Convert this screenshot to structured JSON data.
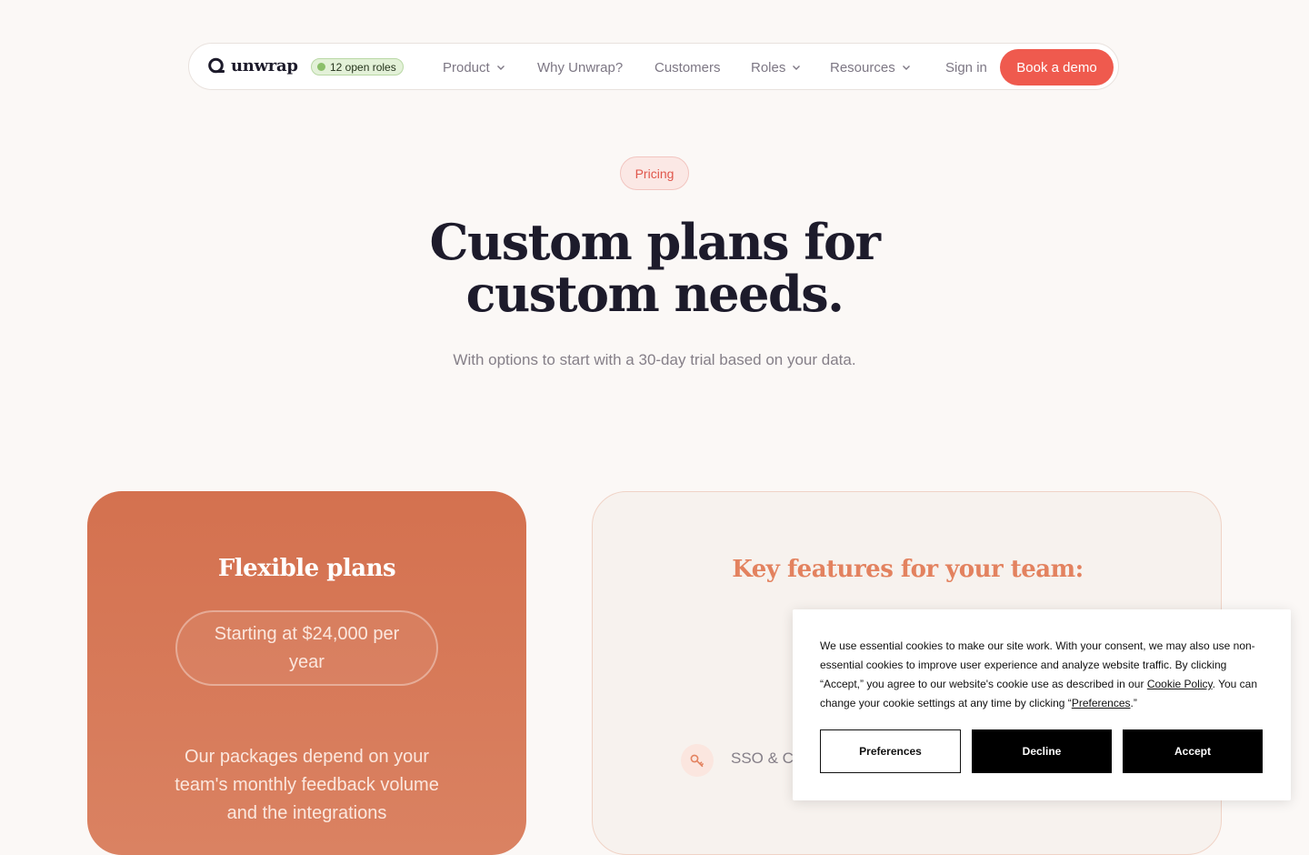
{
  "nav": {
    "logo_text": "unwrap",
    "roles_badge": "12 open roles",
    "items": [
      {
        "label": "Product",
        "dropdown": true
      },
      {
        "label": "Why Unwrap?",
        "dropdown": false
      },
      {
        "label": "Customers",
        "dropdown": false
      },
      {
        "label": "Roles",
        "dropdown": true
      },
      {
        "label": "Resources",
        "dropdown": true
      }
    ],
    "sign_in": "Sign in",
    "book_demo": "Book a demo"
  },
  "hero": {
    "pill": "Pricing",
    "title_line1": "Custom plans for",
    "title_line2": "custom needs.",
    "subtitle": "With options to start with a 30-day trial based on your data."
  },
  "left_card": {
    "title": "Flexible plans",
    "price": "Starting at $24,000 per year",
    "body": "Our packages depend on your team's monthly feedback volume and the integrations"
  },
  "right_card": {
    "title": "Key features for your team:",
    "feature": "SSO & C",
    "feature_icon": "key-icon"
  },
  "cookie": {
    "text_part1": "We use essential cookies to make our site work. With your consent, we may also use non-essential cookies to improve user experience and analyze website traffic. By clicking “Accept,” you agree to our website's cookie use as described in our ",
    "cookie_policy_link": "Cookie Policy",
    "text_part2": ". You can change your cookie settings at any time by clicking “",
    "preferences_link": "Preferences",
    "text_part3": ".”",
    "preferences_button": "Preferences",
    "decline_button": "Decline",
    "accept_button": "Accept"
  },
  "colors": {
    "accent": "#ef5a4e",
    "card_orange": "#d4714f",
    "feature_title": "#e3825f",
    "badge_green": "#e3f1d8"
  }
}
